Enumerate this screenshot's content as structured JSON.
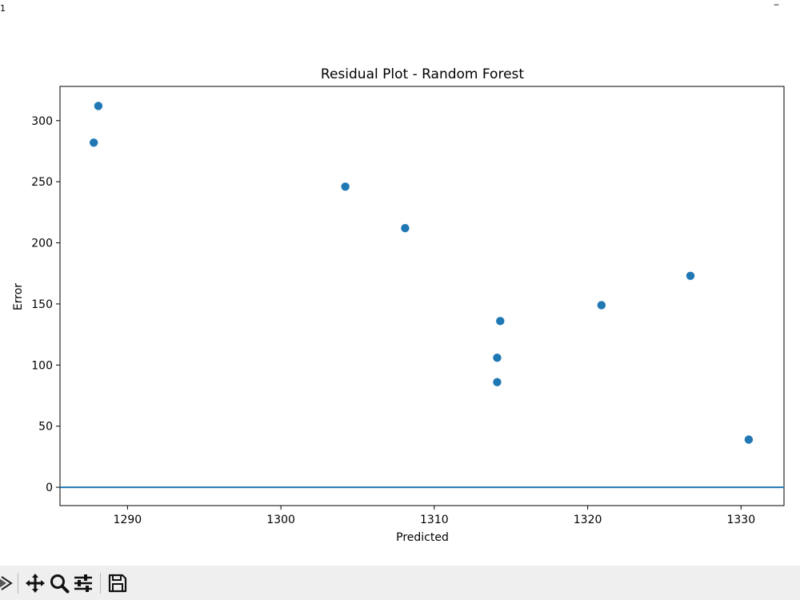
{
  "window": {
    "title": "1",
    "minimize_label": "–"
  },
  "chart_data": {
    "type": "scatter",
    "title": "Residual Plot - Random Forest",
    "xlabel": "Predicted",
    "ylabel": "Error",
    "xlim": [
      1285.6,
      1332.8
    ],
    "ylim": [
      -15,
      328
    ],
    "xticks": [
      1290,
      1300,
      1310,
      1320,
      1330
    ],
    "yticks": [
      0,
      50,
      100,
      150,
      200,
      250,
      300
    ],
    "grid": false,
    "points": [
      {
        "x": 1287.8,
        "y": 282
      },
      {
        "x": 1288.1,
        "y": 312
      },
      {
        "x": 1304.2,
        "y": 246
      },
      {
        "x": 1308.1,
        "y": 212
      },
      {
        "x": 1314.1,
        "y": 106
      },
      {
        "x": 1314.1,
        "y": 86
      },
      {
        "x": 1314.3,
        "y": 136
      },
      {
        "x": 1320.9,
        "y": 149
      },
      {
        "x": 1326.7,
        "y": 173
      },
      {
        "x": 1330.5,
        "y": 39
      }
    ],
    "reference_line_y": 0,
    "colors": {
      "marker": "#1f77b4",
      "line": "#1f77b4"
    }
  },
  "toolbar": {
    "buttons": [
      {
        "name": "forward-button",
        "icon": "forward-arrow-icon"
      },
      {
        "name": "pan-button",
        "icon": "move-icon"
      },
      {
        "name": "zoom-button",
        "icon": "magnifier-icon"
      },
      {
        "name": "configure-subplots-button",
        "icon": "sliders-icon"
      },
      {
        "name": "save-button",
        "icon": "floppy-disk-icon"
      }
    ]
  }
}
